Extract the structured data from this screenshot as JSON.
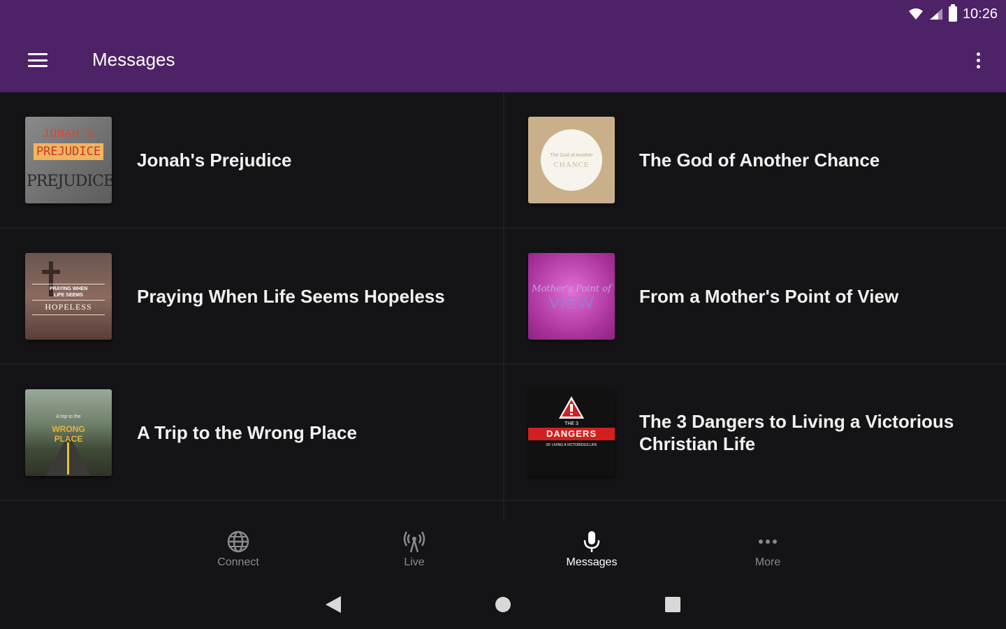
{
  "status_bar": {
    "time": "10:26"
  },
  "app_bar": {
    "title": "Messages"
  },
  "messages": [
    {
      "title": "Jonah's Prejudice",
      "thumb": {
        "line1": "JONAH'S",
        "line2": "PREJUDICE",
        "line3": "PREJUDICES"
      }
    },
    {
      "title": "The God of Another Chance",
      "thumb": {
        "small": "The God of Another",
        "big": "CHANCE"
      }
    },
    {
      "title": "Praying When Life Seems Hopeless",
      "thumb": {
        "line1": "PRAYING WHEN",
        "line2": "LIFE SEEMS",
        "line3": "HOPELESS"
      }
    },
    {
      "title": "From a Mother's Point of View",
      "thumb": {
        "script": "Mother's Point of",
        "word": "VIEW"
      }
    },
    {
      "title": "A Trip to the Wrong Place",
      "thumb": {
        "small": "A trip to the",
        "word1": "WRONG",
        "word2": "PLACE"
      }
    },
    {
      "title": "The 3 Dangers to Living a Victorious Christian Life",
      "thumb": {
        "small": "THE 3",
        "band": "DANGERS",
        "sub": "OF LIVING A VICTORIOUS LIFE"
      }
    }
  ],
  "bottom_nav": [
    {
      "label": "Connect",
      "icon": "globe-icon",
      "active": false
    },
    {
      "label": "Live",
      "icon": "broadcast-icon",
      "active": false
    },
    {
      "label": "Messages",
      "icon": "microphone-icon",
      "active": true
    },
    {
      "label": "More",
      "icon": "more-horizontal-icon",
      "active": false
    }
  ],
  "colors": {
    "primary": "#4d2266",
    "background": "#141416",
    "divider": "#1e1e21",
    "inactive_label": "#8a8a8e"
  }
}
